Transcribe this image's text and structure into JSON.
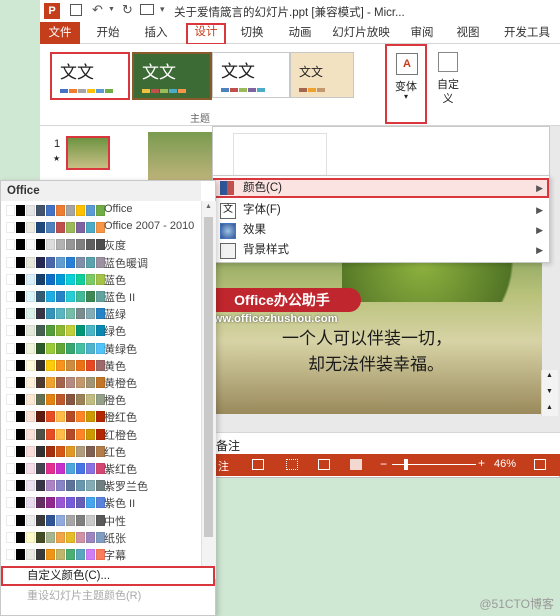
{
  "app": {
    "title": "关于爱情箴言的幻灯片.ppt [兼容模式] - Micr...",
    "logo": "P"
  },
  "tabs": [
    "文件",
    "开始",
    "插入",
    "设计",
    "切换",
    "动画",
    "幻灯片放映",
    "审阅",
    "视图",
    "开发工具"
  ],
  "ribbon": {
    "theme_sample": "文文",
    "theme_sample_alt": "文文",
    "group_theme": "主题",
    "variant_label": "变体",
    "custom_label_1": "自定",
    "custom_label_2": "义"
  },
  "thumb": {
    "number": "1",
    "star": "★"
  },
  "variant_menu": {
    "items": [
      {
        "label": "颜色(C)",
        "icon": "color-palette-icon"
      },
      {
        "label": "字体(F)",
        "icon": "font-icon"
      },
      {
        "label": "效果",
        "icon": "effects-icon"
      },
      {
        "label": "背景样式",
        "icon": "background-style-icon"
      }
    ]
  },
  "colors_panel": {
    "header": "Office",
    "schemes": [
      {
        "name": "Office",
        "swatches": [
          "#ffffff",
          "#000000",
          "#e7e6e6",
          "#44546a",
          "#4472c4",
          "#ed7d31",
          "#a5a5a5",
          "#ffc000",
          "#5b9bd5",
          "#70ad47"
        ]
      },
      {
        "name": "Office 2007 - 2010",
        "swatches": [
          "#ffffff",
          "#000000",
          "#eeece1",
          "#1f497d",
          "#4f81bd",
          "#c0504d",
          "#9bbb59",
          "#8064a2",
          "#4bacc6",
          "#f79646"
        ]
      },
      {
        "name": "灰度",
        "swatches": [
          "#ffffff",
          "#000000",
          "#f8f8f8",
          "#000000",
          "#dddddd",
          "#b2b2b2",
          "#969696",
          "#808080",
          "#5f5f5f",
          "#4d4d4d"
        ]
      },
      {
        "name": "蓝色暖调",
        "swatches": [
          "#ffffff",
          "#000000",
          "#e8e7dc",
          "#242852",
          "#4a66ac",
          "#629dd1",
          "#297fd5",
          "#7f8fa9",
          "#5aa2ae",
          "#9d90a0"
        ]
      },
      {
        "name": "蓝色",
        "swatches": [
          "#ffffff",
          "#000000",
          "#dbeff9",
          "#17406d",
          "#0f6fc6",
          "#009dd9",
          "#0bd0d9",
          "#10cf9b",
          "#7cca62",
          "#a5c249"
        ]
      },
      {
        "name": "蓝色 II",
        "swatches": [
          "#ffffff",
          "#000000",
          "#dbf5f9",
          "#335b74",
          "#1cade4",
          "#2683c6",
          "#27ced7",
          "#42ba97",
          "#3e8853",
          "#62a39f"
        ]
      },
      {
        "name": "蓝绿",
        "swatches": [
          "#ffffff",
          "#000000",
          "#dbf0e9",
          "#373545",
          "#3494ba",
          "#58b6c0",
          "#75bda7",
          "#7a8c8e",
          "#84acb6",
          "#2683c6"
        ]
      },
      {
        "name": "绿色",
        "swatches": [
          "#ffffff",
          "#000000",
          "#e3eadb",
          "#455f51",
          "#549e39",
          "#8ab833",
          "#c0cf3a",
          "#029676",
          "#4ab5c4",
          "#0989b1"
        ]
      },
      {
        "name": "黄绿色",
        "swatches": [
          "#ffffff",
          "#000000",
          "#f0f3db",
          "#2d5a2b",
          "#99cb38",
          "#63a537",
          "#37a76f",
          "#44c1a3",
          "#4eb3cf",
          "#51c3f9"
        ]
      },
      {
        "name": "黄色",
        "swatches": [
          "#ffffff",
          "#000000",
          "#fffadb",
          "#39302a",
          "#ffca08",
          "#f8931d",
          "#ce8d3e",
          "#ec7016",
          "#e64823",
          "#9c6a6a"
        ]
      },
      {
        "name": "黄橙色",
        "swatches": [
          "#ffffff",
          "#000000",
          "#fdf1db",
          "#4e3b30",
          "#f0a22e",
          "#a5644e",
          "#b58b80",
          "#c3986d",
          "#a19574",
          "#c17529"
        ]
      },
      {
        "name": "橙色",
        "swatches": [
          "#ffffff",
          "#000000",
          "#fce6d4",
          "#637052",
          "#e48312",
          "#bd582c",
          "#865640",
          "#9b8357",
          "#c2bc80",
          "#94a088"
        ]
      },
      {
        "name": "橙红色",
        "swatches": [
          "#ffffff",
          "#000000",
          "#fbe2d5",
          "#5e1b0e",
          "#e84c22",
          "#ffbd47",
          "#b64926",
          "#ff8427",
          "#cc9900",
          "#b22600"
        ]
      },
      {
        "name": "红橙色",
        "swatches": [
          "#ffffff",
          "#000000",
          "#f9e0d9",
          "#505046",
          "#e84c22",
          "#ffbd47",
          "#b64926",
          "#ff8427",
          "#cc9900",
          "#b22600"
        ]
      },
      {
        "name": "红色",
        "swatches": [
          "#ffffff",
          "#000000",
          "#f9dcdc",
          "#323232",
          "#a5300f",
          "#d55816",
          "#e19825",
          "#b19c7d",
          "#7f5f52",
          "#b27d49"
        ]
      },
      {
        "name": "紫红色",
        "swatches": [
          "#ffffff",
          "#000000",
          "#f3dde8",
          "#454551",
          "#e32d91",
          "#c830cc",
          "#4ea6dc",
          "#4775e7",
          "#8971e1",
          "#d54773"
        ]
      },
      {
        "name": "紫罗兰色",
        "swatches": [
          "#ffffff",
          "#000000",
          "#ebe1f0",
          "#373545",
          "#ad84c6",
          "#8784c7",
          "#5d739a",
          "#6997af",
          "#84acb6",
          "#6f8183"
        ]
      },
      {
        "name": "紫色 II",
        "swatches": [
          "#ffffff",
          "#000000",
          "#e6dced",
          "#632e62",
          "#92278f",
          "#9b57d3",
          "#755dd9",
          "#665eb8",
          "#45a5ed",
          "#5982db"
        ]
      },
      {
        "name": "中性",
        "swatches": [
          "#ffffff",
          "#000000",
          "#ececec",
          "#3b3b3b",
          "#2f5597",
          "#8faadc",
          "#a6a6a6",
          "#7f7f7f",
          "#c9c9c9",
          "#595959"
        ]
      },
      {
        "name": "纸张",
        "swatches": [
          "#ffffff",
          "#000000",
          "#fefac9",
          "#444d26",
          "#a5b592",
          "#f3a447",
          "#e7bc29",
          "#d092a7",
          "#9c85c0",
          "#809ec2"
        ]
      },
      {
        "name": "字幕",
        "swatches": [
          "#ffffff",
          "#000000",
          "#e9e9e4",
          "#3a3a3a",
          "#f09415",
          "#c1b56b",
          "#4baf73",
          "#5aa6c0",
          "#d17df9",
          "#fa7e5c"
        ]
      }
    ],
    "custom_label": "自定义颜色(C)...",
    "reset_label": "重设幻灯片主题颜色(R)"
  },
  "slide": {
    "line1": "一个人可以伴装一切，",
    "line2": "却无法伴装幸福。"
  },
  "watermark": {
    "badge": "Office办公助手",
    "url": "www.officezhushou.com",
    "corner": "@51CTO博客"
  },
  "notes_label": "备注",
  "status": {
    "notes": "注",
    "zoom": "46%"
  },
  "colors": {
    "accent": "#c43e1c",
    "highlight": "#d9363e"
  }
}
